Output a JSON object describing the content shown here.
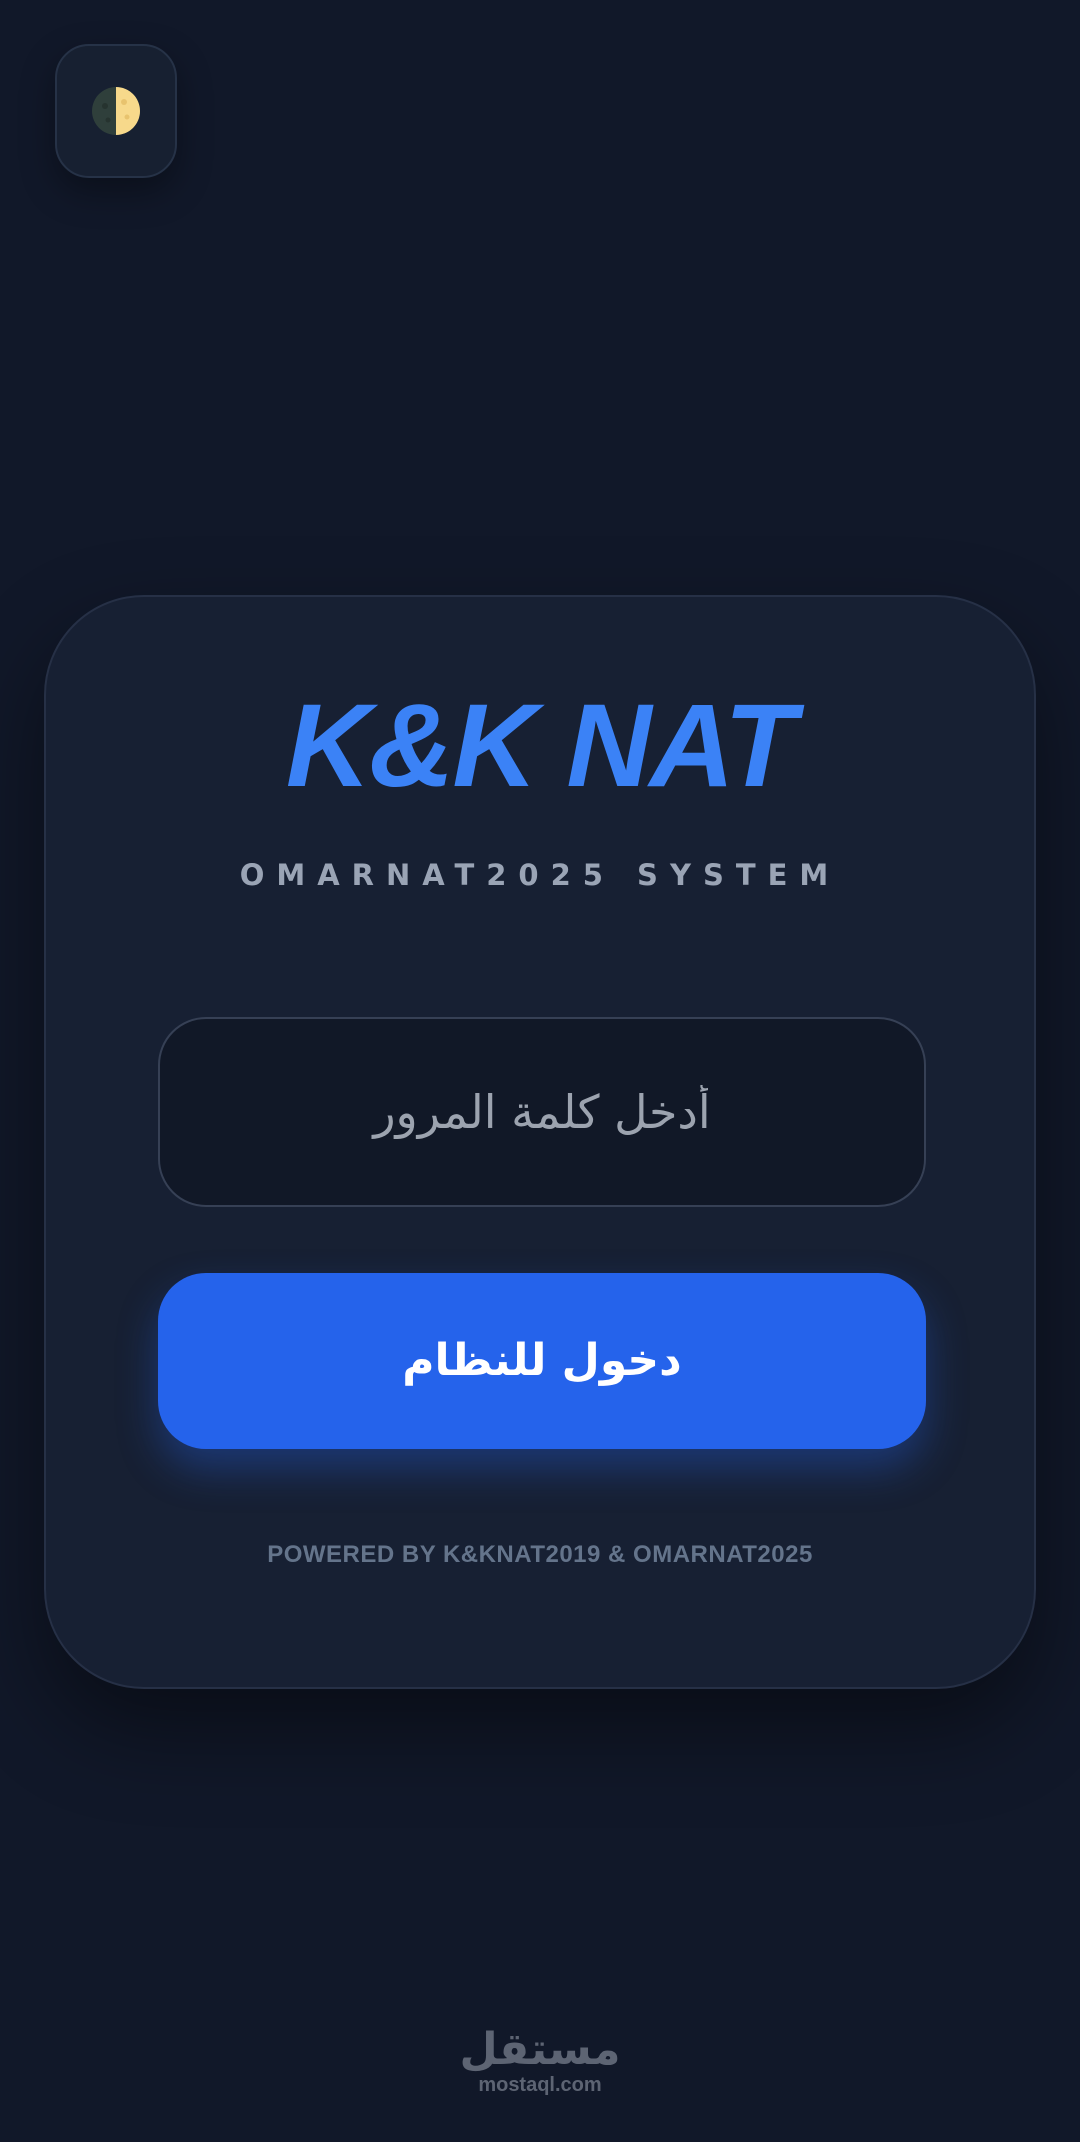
{
  "theme_toggle": {
    "icon": "half-moon-icon"
  },
  "login": {
    "brand": "K&K NAT",
    "subtitle": "OMARNAT2025 SYSTEM",
    "password_placeholder": "أدخل كلمة المرور",
    "login_button_label": "دخول للنظام",
    "footer": "POWERED BY K&KNAT2019 & OMARNAT2025"
  },
  "watermark": {
    "arabic": "مستقل",
    "latin": "mostaql.com"
  },
  "colors": {
    "background": "#111829",
    "card": "#172033",
    "accent": "#3b82f6",
    "button": "#2563eb",
    "moon": "#f7d98b"
  }
}
